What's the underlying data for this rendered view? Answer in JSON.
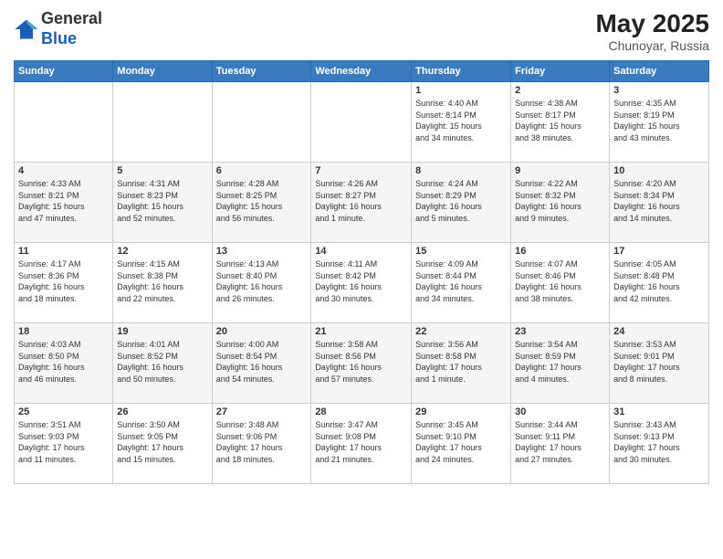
{
  "header": {
    "logo_line1": "General",
    "logo_line2": "Blue",
    "month_year": "May 2025",
    "location": "Chunoyar, Russia"
  },
  "weekdays": [
    "Sunday",
    "Monday",
    "Tuesday",
    "Wednesday",
    "Thursday",
    "Friday",
    "Saturday"
  ],
  "weeks": [
    [
      {
        "day": "",
        "info": ""
      },
      {
        "day": "",
        "info": ""
      },
      {
        "day": "",
        "info": ""
      },
      {
        "day": "",
        "info": ""
      },
      {
        "day": "1",
        "info": "Sunrise: 4:40 AM\nSunset: 8:14 PM\nDaylight: 15 hours\nand 34 minutes."
      },
      {
        "day": "2",
        "info": "Sunrise: 4:38 AM\nSunset: 8:17 PM\nDaylight: 15 hours\nand 38 minutes."
      },
      {
        "day": "3",
        "info": "Sunrise: 4:35 AM\nSunset: 8:19 PM\nDaylight: 15 hours\nand 43 minutes."
      }
    ],
    [
      {
        "day": "4",
        "info": "Sunrise: 4:33 AM\nSunset: 8:21 PM\nDaylight: 15 hours\nand 47 minutes."
      },
      {
        "day": "5",
        "info": "Sunrise: 4:31 AM\nSunset: 8:23 PM\nDaylight: 15 hours\nand 52 minutes."
      },
      {
        "day": "6",
        "info": "Sunrise: 4:28 AM\nSunset: 8:25 PM\nDaylight: 15 hours\nand 56 minutes."
      },
      {
        "day": "7",
        "info": "Sunrise: 4:26 AM\nSunset: 8:27 PM\nDaylight: 16 hours\nand 1 minute."
      },
      {
        "day": "8",
        "info": "Sunrise: 4:24 AM\nSunset: 8:29 PM\nDaylight: 16 hours\nand 5 minutes."
      },
      {
        "day": "9",
        "info": "Sunrise: 4:22 AM\nSunset: 8:32 PM\nDaylight: 16 hours\nand 9 minutes."
      },
      {
        "day": "10",
        "info": "Sunrise: 4:20 AM\nSunset: 8:34 PM\nDaylight: 16 hours\nand 14 minutes."
      }
    ],
    [
      {
        "day": "11",
        "info": "Sunrise: 4:17 AM\nSunset: 8:36 PM\nDaylight: 16 hours\nand 18 minutes."
      },
      {
        "day": "12",
        "info": "Sunrise: 4:15 AM\nSunset: 8:38 PM\nDaylight: 16 hours\nand 22 minutes."
      },
      {
        "day": "13",
        "info": "Sunrise: 4:13 AM\nSunset: 8:40 PM\nDaylight: 16 hours\nand 26 minutes."
      },
      {
        "day": "14",
        "info": "Sunrise: 4:11 AM\nSunset: 8:42 PM\nDaylight: 16 hours\nand 30 minutes."
      },
      {
        "day": "15",
        "info": "Sunrise: 4:09 AM\nSunset: 8:44 PM\nDaylight: 16 hours\nand 34 minutes."
      },
      {
        "day": "16",
        "info": "Sunrise: 4:07 AM\nSunset: 8:46 PM\nDaylight: 16 hours\nand 38 minutes."
      },
      {
        "day": "17",
        "info": "Sunrise: 4:05 AM\nSunset: 8:48 PM\nDaylight: 16 hours\nand 42 minutes."
      }
    ],
    [
      {
        "day": "18",
        "info": "Sunrise: 4:03 AM\nSunset: 8:50 PM\nDaylight: 16 hours\nand 46 minutes."
      },
      {
        "day": "19",
        "info": "Sunrise: 4:01 AM\nSunset: 8:52 PM\nDaylight: 16 hours\nand 50 minutes."
      },
      {
        "day": "20",
        "info": "Sunrise: 4:00 AM\nSunset: 8:54 PM\nDaylight: 16 hours\nand 54 minutes."
      },
      {
        "day": "21",
        "info": "Sunrise: 3:58 AM\nSunset: 8:56 PM\nDaylight: 16 hours\nand 57 minutes."
      },
      {
        "day": "22",
        "info": "Sunrise: 3:56 AM\nSunset: 8:58 PM\nDaylight: 17 hours\nand 1 minute."
      },
      {
        "day": "23",
        "info": "Sunrise: 3:54 AM\nSunset: 8:59 PM\nDaylight: 17 hours\nand 4 minutes."
      },
      {
        "day": "24",
        "info": "Sunrise: 3:53 AM\nSunset: 9:01 PM\nDaylight: 17 hours\nand 8 minutes."
      }
    ],
    [
      {
        "day": "25",
        "info": "Sunrise: 3:51 AM\nSunset: 9:03 PM\nDaylight: 17 hours\nand 11 minutes."
      },
      {
        "day": "26",
        "info": "Sunrise: 3:50 AM\nSunset: 9:05 PM\nDaylight: 17 hours\nand 15 minutes."
      },
      {
        "day": "27",
        "info": "Sunrise: 3:48 AM\nSunset: 9:06 PM\nDaylight: 17 hours\nand 18 minutes."
      },
      {
        "day": "28",
        "info": "Sunrise: 3:47 AM\nSunset: 9:08 PM\nDaylight: 17 hours\nand 21 minutes."
      },
      {
        "day": "29",
        "info": "Sunrise: 3:45 AM\nSunset: 9:10 PM\nDaylight: 17 hours\nand 24 minutes."
      },
      {
        "day": "30",
        "info": "Sunrise: 3:44 AM\nSunset: 9:11 PM\nDaylight: 17 hours\nand 27 minutes."
      },
      {
        "day": "31",
        "info": "Sunrise: 3:43 AM\nSunset: 9:13 PM\nDaylight: 17 hours\nand 30 minutes."
      }
    ]
  ]
}
